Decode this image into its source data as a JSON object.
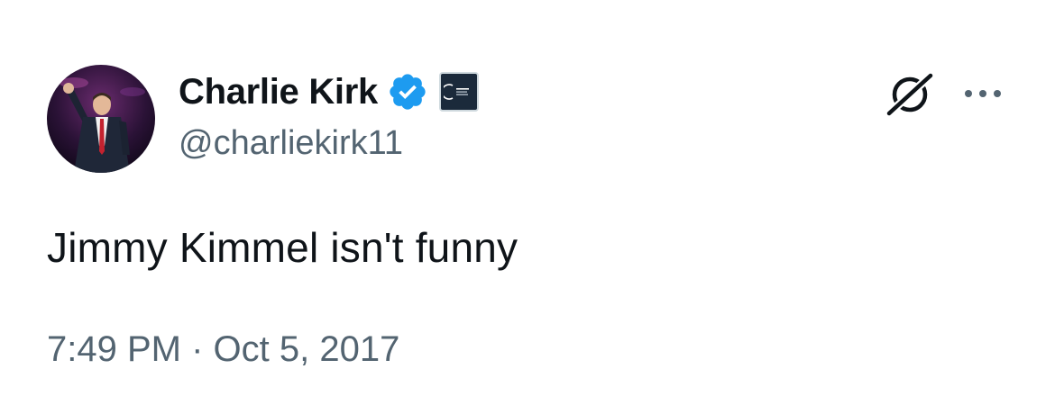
{
  "author": {
    "display_name": "Charlie Kirk",
    "handle": "@charliekirk11",
    "verified_badge_color": "#1d9bf0"
  },
  "tweet": {
    "text": "Jimmy Kimmel isn't funny",
    "timestamp": "7:49 PM · Oct 5, 2017"
  },
  "icons": {
    "verified": "verified-check-icon",
    "affiliate": "affiliate-badge-icon",
    "grok": "grok-icon",
    "more": "more-options-icon"
  },
  "colors": {
    "text_primary": "#0f1419",
    "text_secondary": "#536471",
    "background": "#ffffff"
  }
}
